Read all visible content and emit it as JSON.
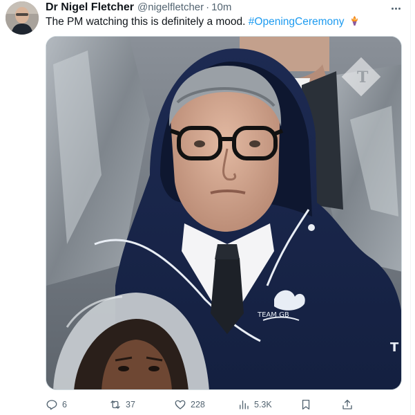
{
  "tweet": {
    "author": {
      "display_name": "Dr Nigel Fletcher",
      "handle": "@nigelfletcher",
      "separator": "·",
      "time": "10m",
      "avatar_icon": "user-avatar"
    },
    "text": {
      "body": "The PM watching this is definitely a mood.",
      "hashtag": "#OpeningCeremony",
      "emoji_icon": "torch-emoji-icon"
    },
    "media": {
      "kind": "photo",
      "jacket_print": "TEAM GB",
      "watermark_icon": "telegraph-watermark-icon"
    },
    "actions": {
      "replies": "6",
      "reposts": "37",
      "likes": "228",
      "views": "5.3K"
    }
  },
  "colors": {
    "text_primary": "#0f1419",
    "text_secondary": "#536471",
    "link": "#1d9bf0",
    "border": "#cfd9de"
  }
}
